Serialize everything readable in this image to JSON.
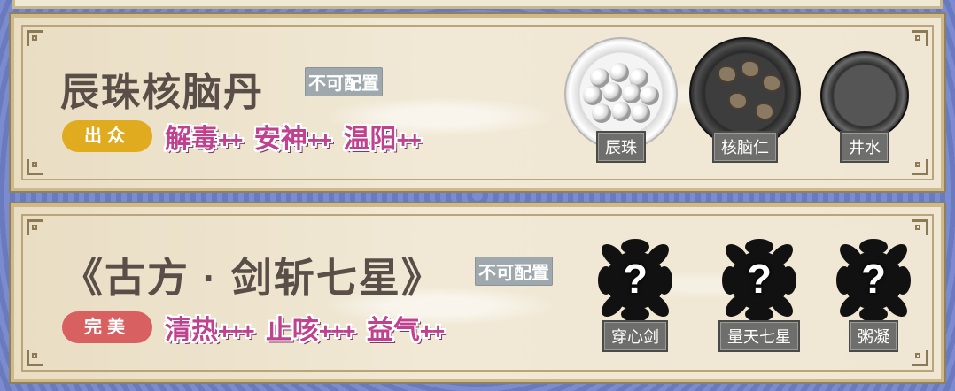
{
  "recipes": [
    {
      "title": "辰珠核脑丹",
      "config_badge": "不可配置",
      "grade": "出众",
      "grade_color": "#e0ab1f",
      "effects": [
        {
          "name": "解毒",
          "plus": "++"
        },
        {
          "name": "安神",
          "plus": "++"
        },
        {
          "name": "温阳",
          "plus": "++"
        }
      ],
      "ingredients": [
        {
          "name": "辰珠",
          "icon": "pearls-plate-icon"
        },
        {
          "name": "核脑仁",
          "icon": "walnut-plate-icon"
        },
        {
          "name": "井水",
          "icon": "water-bowl-icon"
        }
      ]
    },
    {
      "title": "《古方 · 剑斩七星》",
      "config_badge": "不可配置",
      "grade": "完美",
      "grade_color": "#d86060",
      "effects": [
        {
          "name": "清热",
          "plus": "+++"
        },
        {
          "name": "止咳",
          "plus": "+++"
        },
        {
          "name": "益气",
          "plus": "++"
        }
      ],
      "ingredients": [
        {
          "name": "穿心剑",
          "icon": "unknown-ingredient-icon",
          "symbol": "?"
        },
        {
          "name": "量天七星",
          "icon": "unknown-ingredient-icon",
          "symbol": "?"
        },
        {
          "name": "粥凝",
          "icon": "unknown-ingredient-icon",
          "symbol": "?"
        }
      ]
    }
  ]
}
